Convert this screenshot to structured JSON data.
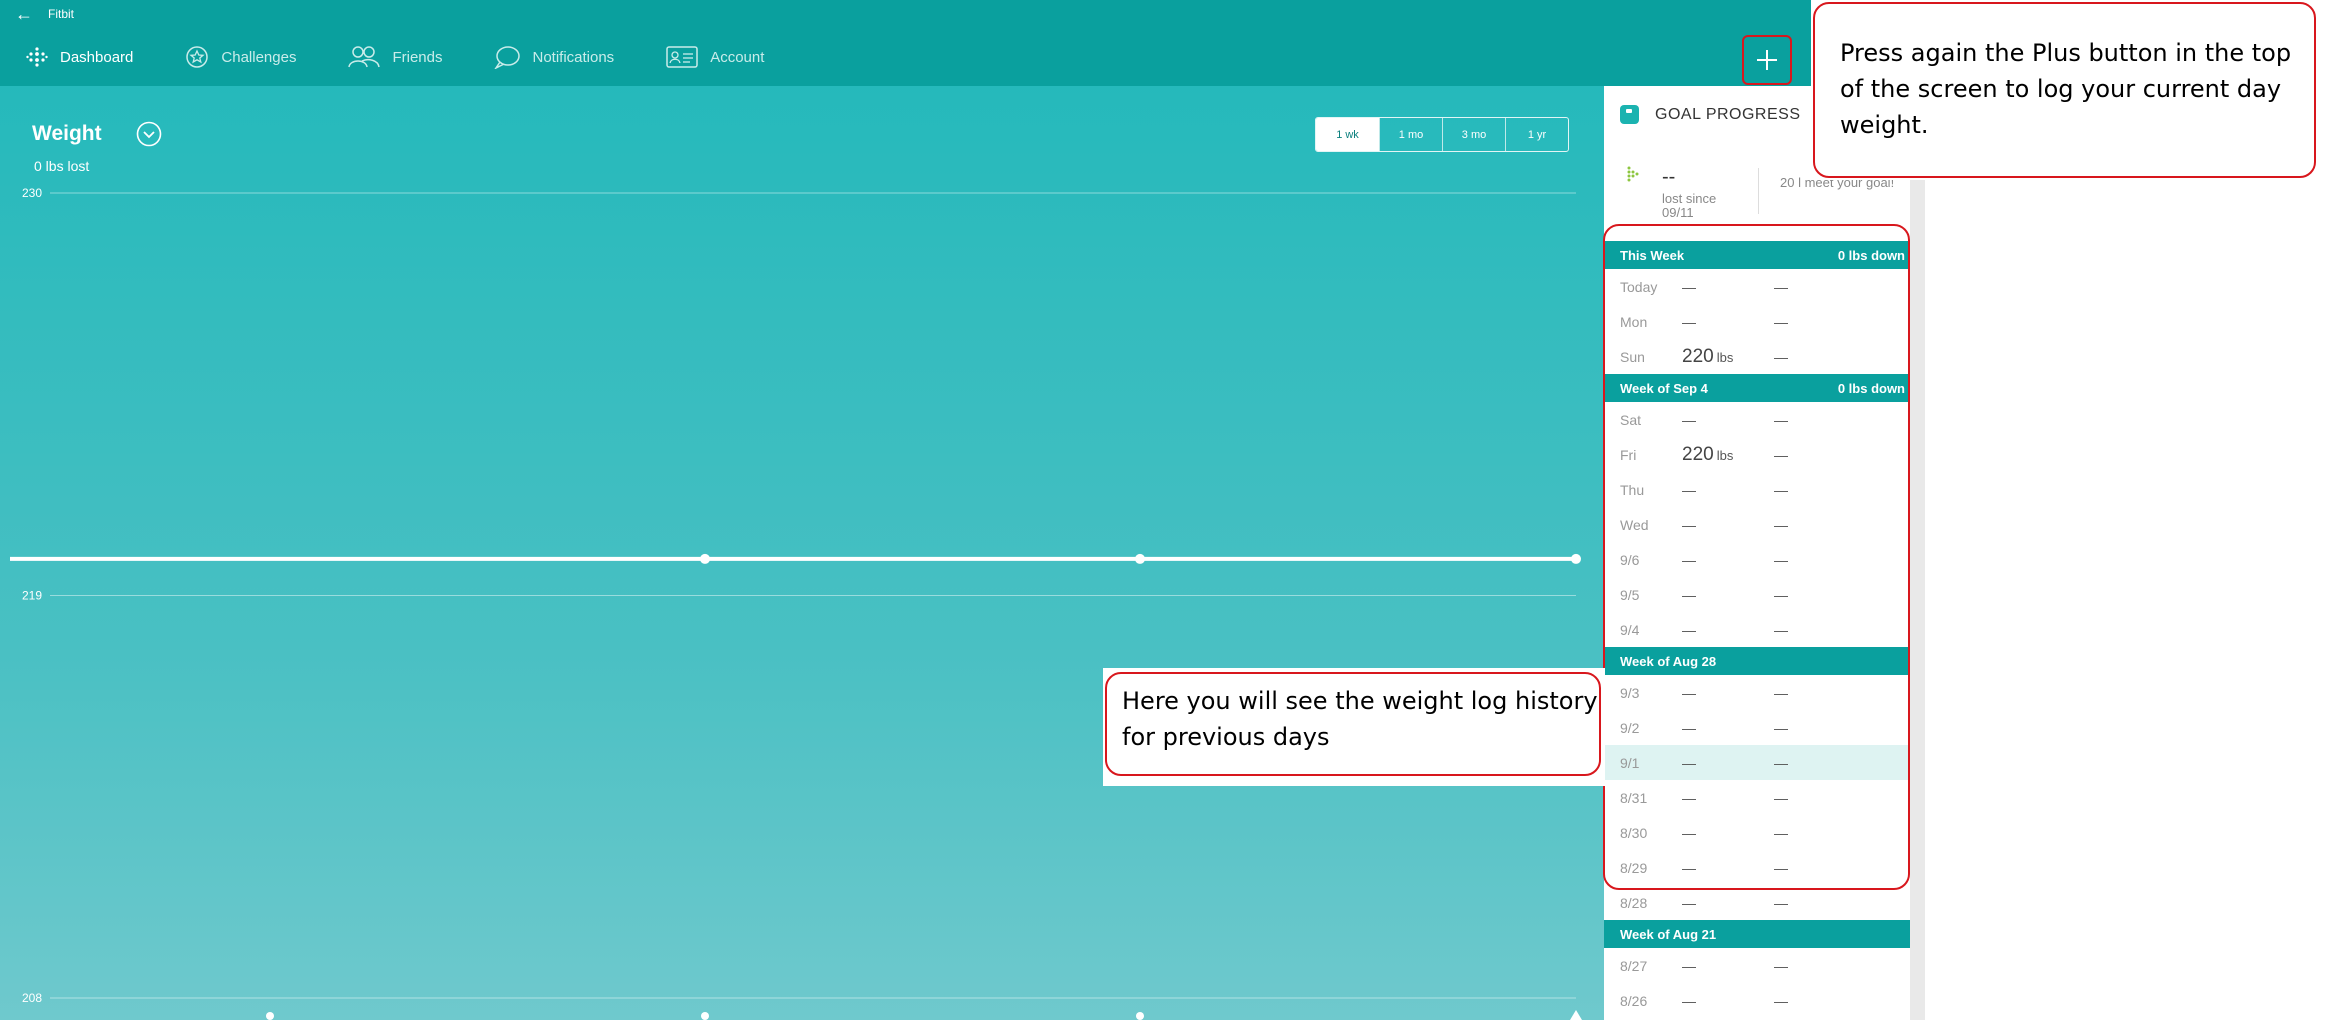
{
  "titlebar": {
    "back_glyph": "←",
    "app_title": "Fitbit"
  },
  "nav": {
    "items": [
      {
        "label": "Dashboard",
        "icon": "dots-grid-icon"
      },
      {
        "label": "Challenges",
        "icon": "star-badge-icon"
      },
      {
        "label": "Friends",
        "icon": "friends-icon"
      },
      {
        "label": "Notifications",
        "icon": "speech-bubble-icon"
      },
      {
        "label": "Account",
        "icon": "id-card-icon"
      }
    ],
    "active": "Dashboard"
  },
  "weight": {
    "title": "Weight",
    "subtitle": "0 lbs lost",
    "ranges": [
      "1 wk",
      "1 mo",
      "3 mo",
      "1 yr"
    ],
    "active_range": "1 wk"
  },
  "chart_data": {
    "type": "line",
    "y_ticks": [
      "230",
      "219",
      "208"
    ],
    "ylim": [
      208,
      230
    ],
    "series": [
      {
        "values": [
          220,
          220,
          220,
          220
        ]
      }
    ]
  },
  "goal": {
    "label": "GOAL PROGRESS",
    "value": "--",
    "note": "lost since 09/11",
    "remaining": "20 l meet your goal!"
  },
  "log": [
    {
      "type": "header",
      "label": "This Week",
      "change": "0 lbs down"
    },
    {
      "type": "row",
      "day": "Today",
      "weight": "",
      "unit": "",
      "change": "—"
    },
    {
      "type": "row",
      "day": "Mon",
      "weight": "",
      "unit": "",
      "change": "—"
    },
    {
      "type": "row",
      "day": "Sun",
      "weight": "220",
      "unit": "lbs",
      "change": "—"
    },
    {
      "type": "header",
      "label": "Week of Sep 4",
      "change": "0 lbs down"
    },
    {
      "type": "row",
      "day": "Sat",
      "weight": "",
      "unit": "",
      "change": "—"
    },
    {
      "type": "row",
      "day": "Fri",
      "weight": "220",
      "unit": "lbs",
      "change": "—"
    },
    {
      "type": "row",
      "day": "Thu",
      "weight": "",
      "unit": "",
      "change": "—"
    },
    {
      "type": "row",
      "day": "Wed",
      "weight": "",
      "unit": "",
      "change": "—"
    },
    {
      "type": "row",
      "day": "9/6",
      "weight": "",
      "unit": "",
      "change": "—"
    },
    {
      "type": "row",
      "day": "9/5",
      "weight": "",
      "unit": "",
      "change": "—"
    },
    {
      "type": "row",
      "day": "9/4",
      "weight": "",
      "unit": "",
      "change": "—"
    },
    {
      "type": "header",
      "label": "Week of Aug 28",
      "change": ""
    },
    {
      "type": "row",
      "day": "9/3",
      "weight": "",
      "unit": "",
      "change": "—"
    },
    {
      "type": "row",
      "day": "9/2",
      "weight": "",
      "unit": "",
      "change": "—"
    },
    {
      "type": "row",
      "day": "9/1",
      "weight": "",
      "unit": "",
      "change": "—",
      "highlight": true
    },
    {
      "type": "row",
      "day": "8/31",
      "weight": "",
      "unit": "",
      "change": "—"
    },
    {
      "type": "row",
      "day": "8/30",
      "weight": "",
      "unit": "",
      "change": "—"
    },
    {
      "type": "row",
      "day": "8/29",
      "weight": "",
      "unit": "",
      "change": "—"
    },
    {
      "type": "row",
      "day": "8/28",
      "weight": "",
      "unit": "",
      "change": "—"
    },
    {
      "type": "header",
      "label": "Week of Aug 21",
      "change": ""
    },
    {
      "type": "row",
      "day": "8/27",
      "weight": "",
      "unit": "",
      "change": "—"
    },
    {
      "type": "row",
      "day": "8/26",
      "weight": "",
      "unit": "",
      "change": "—"
    }
  ],
  "annotations": {
    "plus_text": "Press again the Plus button in the top of the screen to log your current day weight.",
    "history_text": "Here you will see the weight log history for previous days"
  },
  "colors": {
    "teal": "#0aa09e",
    "annotation_red": "#d8171d"
  }
}
